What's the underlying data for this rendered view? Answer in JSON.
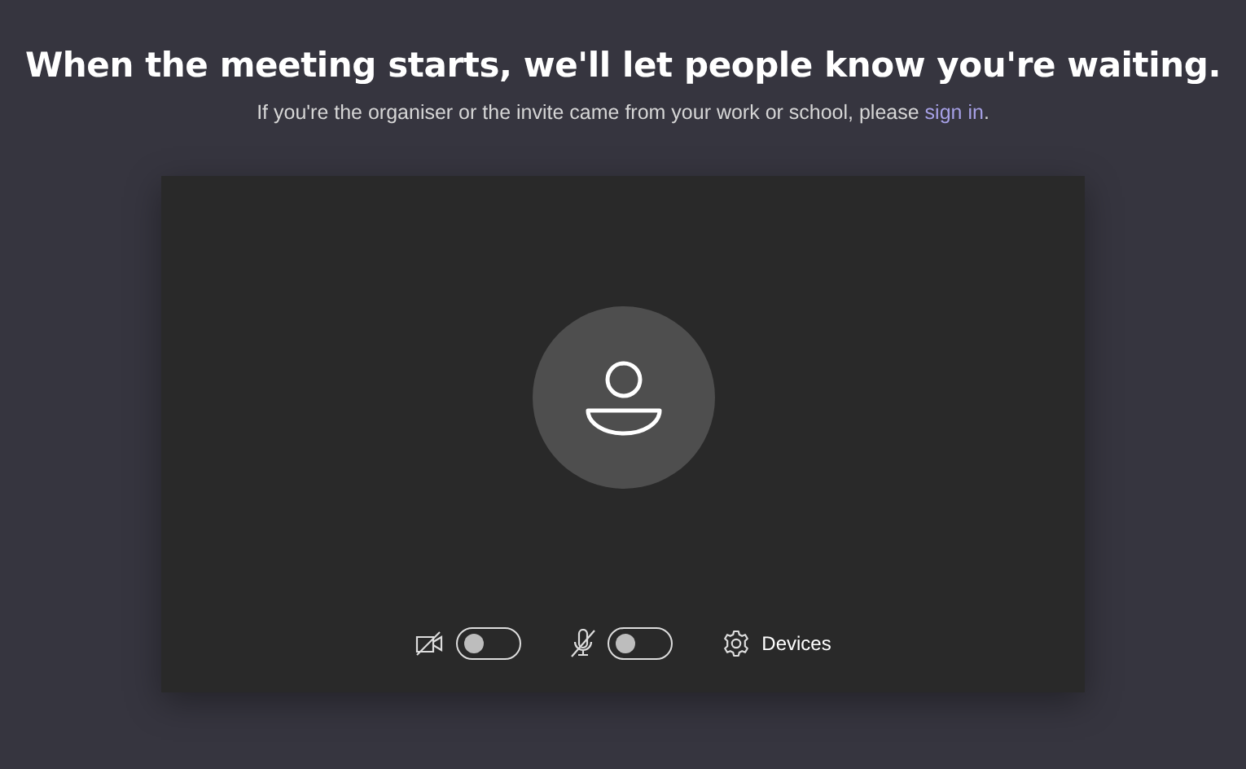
{
  "heading": "When the meeting starts, we'll let people know you're waiting.",
  "subtitle": {
    "text": "If you're the organiser or the invite came from your work or school, please ",
    "link": "sign in",
    "after": "."
  },
  "controls": [
    {
      "kind": "camera",
      "on": false
    },
    {
      "kind": "microphone",
      "on": false
    },
    {
      "kind": "devices",
      "label": "Devices"
    }
  ]
}
